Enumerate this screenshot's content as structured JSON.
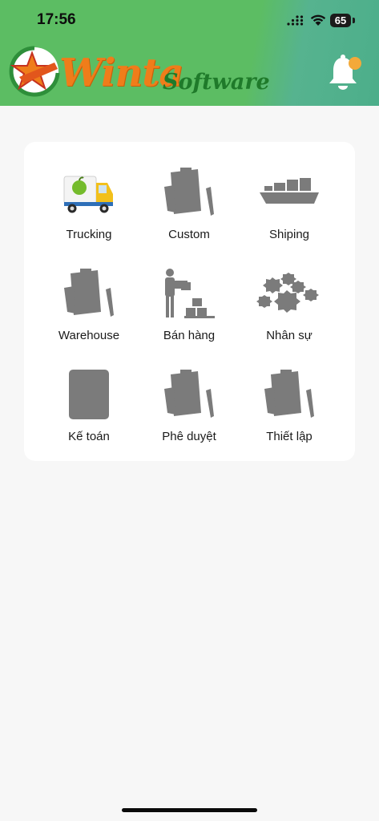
{
  "status_bar": {
    "time": "17:56",
    "battery": "65"
  },
  "header": {
    "brand_name": "Winta",
    "brand_sub": "Software",
    "bell_icon": "bell-icon"
  },
  "menu": {
    "items": [
      {
        "label": "Trucking",
        "icon": "truck-icon"
      },
      {
        "label": "Custom",
        "icon": "clipboard-icon"
      },
      {
        "label": "Shiping",
        "icon": "ship-icon"
      },
      {
        "label": "Warehouse",
        "icon": "clipboard-icon"
      },
      {
        "label": "Bán hàng",
        "icon": "worker-boxes-icon"
      },
      {
        "label": "Nhân sự",
        "icon": "gears-icon"
      },
      {
        "label": "Kế toán",
        "icon": "tablet-icon"
      },
      {
        "label": "Phê duyệt",
        "icon": "clipboard-icon"
      },
      {
        "label": "Thiết lập",
        "icon": "clipboard-icon"
      }
    ]
  },
  "colors": {
    "header_green": "#5cbd63",
    "brand_orange": "#ef7d1a",
    "brand_dark_green": "#1f7a2a",
    "icon_gray": "#7b7b7b",
    "notification_dot": "#f3a93a"
  }
}
